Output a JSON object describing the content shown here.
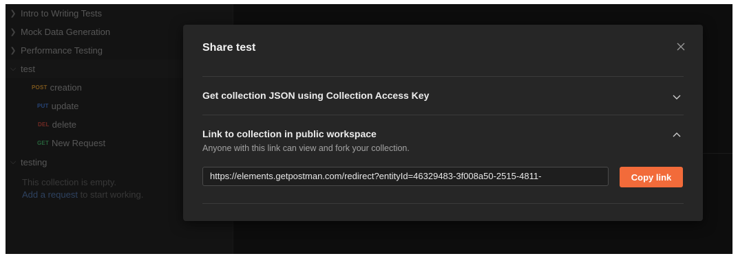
{
  "sidebar": {
    "folders_top": [
      {
        "label": "Intro to Writing Tests",
        "expanded": false
      },
      {
        "label": "Mock Data Generation",
        "expanded": false
      },
      {
        "label": "Performance Testing",
        "expanded": false
      }
    ],
    "test_folder": {
      "label": "test",
      "expanded": true,
      "requests": [
        {
          "method": "POST",
          "label": "creation",
          "color": "#c58a2e"
        },
        {
          "method": "PUT",
          "label": "update",
          "color": "#3f6fc0"
        },
        {
          "method": "DEL",
          "label": "delete",
          "color": "#b8453a"
        },
        {
          "method": "GET",
          "label": "New Request",
          "color": "#3e9e5e"
        }
      ]
    },
    "testing_folder": {
      "label": "testing",
      "expanded": true,
      "empty_text": "This collection is empty.",
      "add_link": "Add a request",
      "add_suffix": " to start working."
    }
  },
  "modal": {
    "title": "Share test",
    "sections": [
      {
        "title": "Get collection JSON using Collection Access Key",
        "expanded": false
      },
      {
        "title": "Link to collection in public workspace",
        "description": "Anyone with this link can view and fork your collection.",
        "expanded": true,
        "link_value": "https://elements.getpostman.com/redirect?entityId=46329483-3f008a50-2515-4811-",
        "copy_label": "Copy link"
      }
    ]
  },
  "colors": {
    "accent": "#f26b3a",
    "background": "#1b1b1b",
    "modal": "#262626"
  },
  "icons": {
    "close": "close-icon",
    "collapsed": "chevron-right-icon",
    "expanded": "chevron-down-icon",
    "collapse": "chevron-up-icon"
  }
}
